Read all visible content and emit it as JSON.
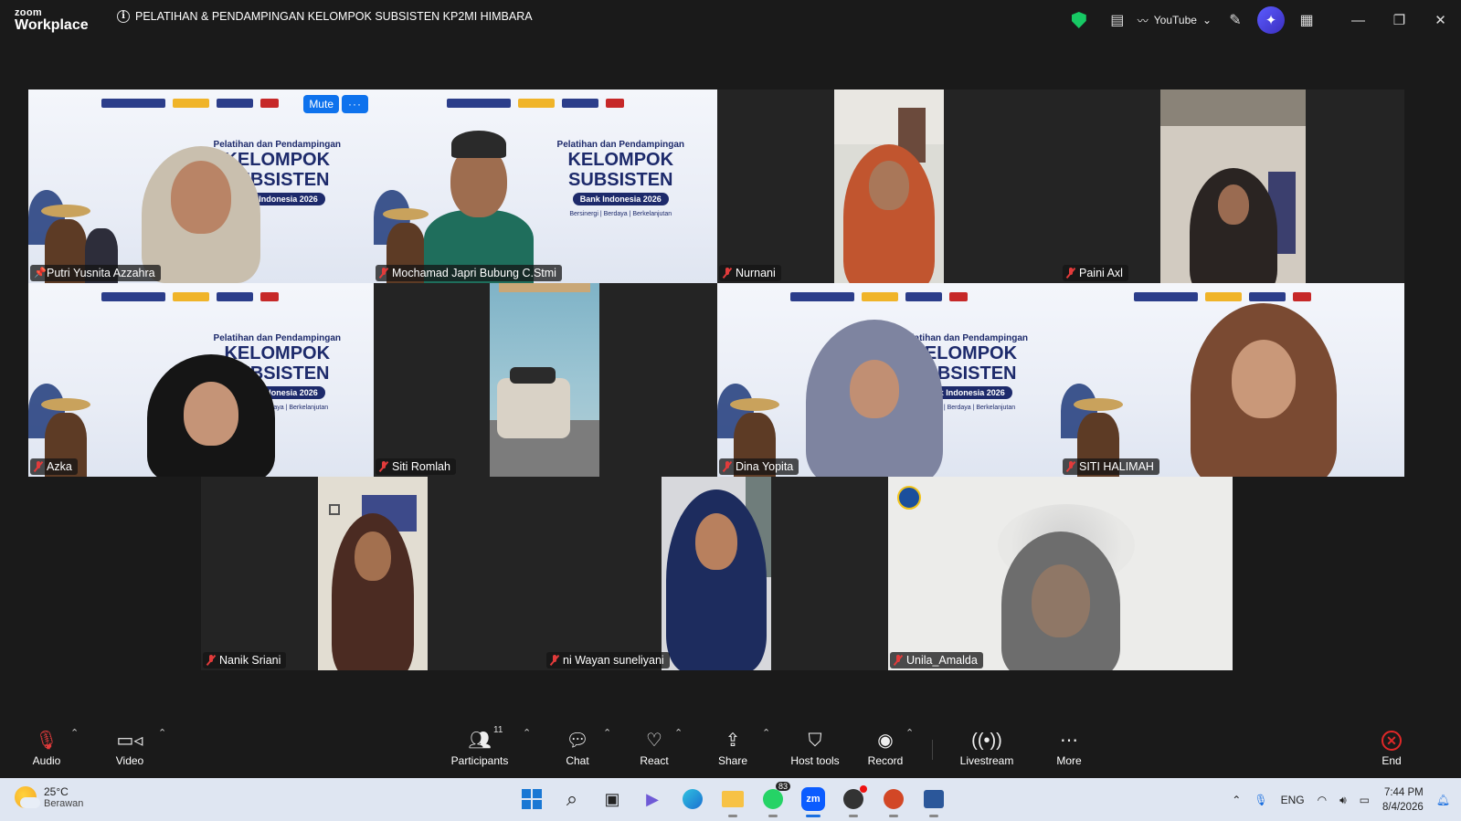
{
  "app": {
    "brand_top": "zoom",
    "brand_bottom": "Workplace",
    "meeting_title": "PELATIHAN & PENDAMPINGAN KELOMPOK SUBSISTEN KP2MI HIMBARA",
    "app_label": "YouTube",
    "accent": "#0e72ed"
  },
  "tile_controls": {
    "mute": "Mute",
    "more": "···"
  },
  "slide": {
    "line1": "Pelatihan dan Pendampingan",
    "line2": "KELOMPOK",
    "line3": "SUBSISTEN",
    "badge": "Bank Indonesia 2026",
    "tagline": "Bersinergi | Berdaya | Berkelanjutan"
  },
  "participants": [
    {
      "name": "Putri Yusnita Azzahra",
      "muted": false,
      "pinned": true
    },
    {
      "name": "Mochamad Japri Bubung C.Stmi",
      "muted": true
    },
    {
      "name": "Nurnani",
      "muted": true
    },
    {
      "name": "Paini Axl",
      "muted": true
    },
    {
      "name": "Azka",
      "muted": true
    },
    {
      "name": "Siti Romlah",
      "muted": true
    },
    {
      "name": "Dina Yopita",
      "muted": true
    },
    {
      "name": "SITI HALIMAH",
      "muted": true
    },
    {
      "name": "Nanik Sriani",
      "muted": true
    },
    {
      "name": "ni Wayan suneliyani",
      "muted": true
    },
    {
      "name": "Unila_Amalda",
      "muted": true
    }
  ],
  "toolbar": {
    "audio": "Audio",
    "video": "Video",
    "participants": "Participants",
    "participant_count": "11",
    "chat": "Chat",
    "react": "React",
    "share": "Share",
    "host_tools": "Host tools",
    "record": "Record",
    "livestream": "Livestream",
    "more": "More",
    "end": "End"
  },
  "taskbar": {
    "temperature": "25°C",
    "weather": "Berawan",
    "whatsapp_badge": "83",
    "language": "ENG",
    "time": "7:44 PM",
    "date": "8/4/2026"
  }
}
